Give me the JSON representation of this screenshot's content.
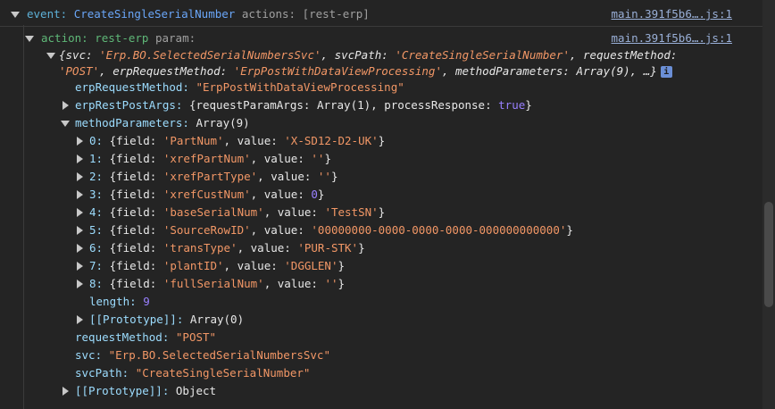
{
  "header": {
    "event_label": "event:",
    "event_name": "CreateSingleSerialNumber",
    "actions_text": "actions: [rest-erp]",
    "source": "main.391f5b6….js:1"
  },
  "group": {
    "action_label": "action:",
    "action_name": "rest-erp",
    "param_label": "param:",
    "source": "main.391f5b6….js:1"
  },
  "summary": {
    "line1_prefix": "{svc: ",
    "line1_svc": "'Erp.BO.SelectedSerialNumbersSvc'",
    "line1_mid": ", svcPath: ",
    "line1_path": "'CreateSingleSerialNumber'",
    "line1_tail": ", requestMethod:",
    "line2_method": "'POST'",
    "line2_mid": ", erpRequestMethod: ",
    "line2_erm": "'ErpPostWithDataViewProcessing'",
    "line2_tail": ", methodParameters: Array(9), …}",
    "info": "i"
  },
  "props": {
    "erpRequestMethod_key": "erpRequestMethod:",
    "erpRequestMethod_val": "\"ErpPostWithDataViewProcessing\"",
    "erpRestPostArgs_key": "erpRestPostArgs:",
    "erpRestPostArgs_val1": "{requestParamArgs: Array(1), processResponse: ",
    "erpRestPostArgs_bool": "true",
    "erpRestPostArgs_val2": "}",
    "methodParameters_key": "methodParameters:",
    "methodParameters_val": "Array(9)",
    "length_key": "length:",
    "length_val": "9",
    "proto_key": "[[Prototype]]:",
    "proto_val": "Array(0)",
    "requestMethod_key": "requestMethod:",
    "requestMethod_val": "\"POST\"",
    "svc_key": "svc:",
    "svc_val": "\"Erp.BO.SelectedSerialNumbersSvc\"",
    "svcPath_key": "svcPath:",
    "svcPath_val": "\"CreateSingleSerialNumber\"",
    "objproto_key": "[[Prototype]]:",
    "objproto_val": "Object"
  },
  "items": [
    {
      "idx": "0:",
      "field": "'PartNum'",
      "value": "'X-SD12-D2-UK'",
      "numeric": false
    },
    {
      "idx": "1:",
      "field": "'xrefPartNum'",
      "value": "''",
      "numeric": false
    },
    {
      "idx": "2:",
      "field": "'xrefPartType'",
      "value": "''",
      "numeric": false
    },
    {
      "idx": "3:",
      "field": "'xrefCustNum'",
      "value": "0",
      "numeric": true
    },
    {
      "idx": "4:",
      "field": "'baseSerialNum'",
      "value": "'TestSN'",
      "numeric": false
    },
    {
      "idx": "5:",
      "field": "'SourceRowID'",
      "value": "'00000000-0000-0000-0000-000000000000'",
      "numeric": false
    },
    {
      "idx": "6:",
      "field": "'transType'",
      "value": "'PUR-STK'",
      "numeric": false
    },
    {
      "idx": "7:",
      "field": "'plantID'",
      "value": "'DGGLEN'",
      "numeric": false
    },
    {
      "idx": "8:",
      "field": "'fullSerialNum'",
      "value": "''",
      "numeric": false
    }
  ],
  "item_text": {
    "open": "{field: ",
    "mid": ", value: ",
    "close": "}"
  }
}
